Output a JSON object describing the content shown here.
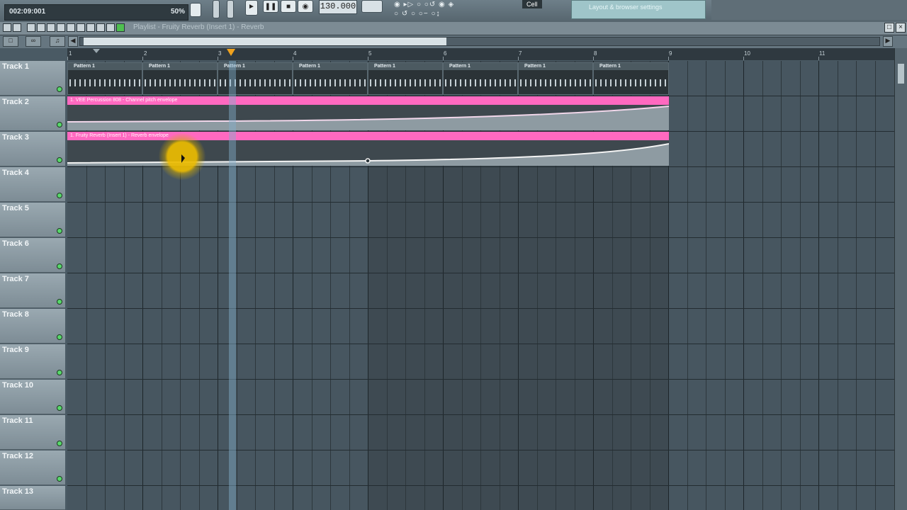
{
  "toolbar": {
    "hint_time": "002:09:001",
    "hint_zoom": "50%",
    "tempo": "130.000",
    "cell_label": "Cell",
    "preset_text": "Layout & browser settings"
  },
  "playlist": {
    "window_title": "Playlist - Fruity Reverb (Insert 1) - Reverb",
    "bar_numbers": [
      "1",
      "2",
      "3",
      "4",
      "5",
      "6",
      "7",
      "8",
      "9",
      "10",
      "11"
    ],
    "tracks": [
      "Track 1",
      "Track 2",
      "Track 3",
      "Track 4",
      "Track 5",
      "Track 6",
      "Track 7",
      "Track 8",
      "Track 9",
      "Track 10",
      "Track 11",
      "Track 12",
      "Track 13"
    ],
    "pattern_clips": [
      "Pattern 1",
      "Pattern 1",
      "Pattern 1",
      "Pattern 1",
      "Pattern 1",
      "Pattern 1",
      "Pattern 1",
      "Pattern 1"
    ],
    "automation_clips": [
      {
        "title": "1. VEE Percussion 808 - Channel pitch envelope"
      },
      {
        "title": "1. Fruity Reverb (Insert 1) - Reverb envelope"
      }
    ]
  },
  "colors": {
    "automation_clip": "#ff69c0",
    "song_marker": "#f0a21d",
    "cursor_highlight": "#ecbc00",
    "track_led": "#57d86a"
  },
  "icons": [
    "play-icon",
    "stop-icon",
    "record-icon",
    "pencil-icon",
    "brush-icon",
    "delete-icon",
    "mute-icon",
    "slice-icon",
    "select-icon",
    "zoom-icon",
    "speaker-icon",
    "arrow-left-icon",
    "arrow-right-icon"
  ]
}
